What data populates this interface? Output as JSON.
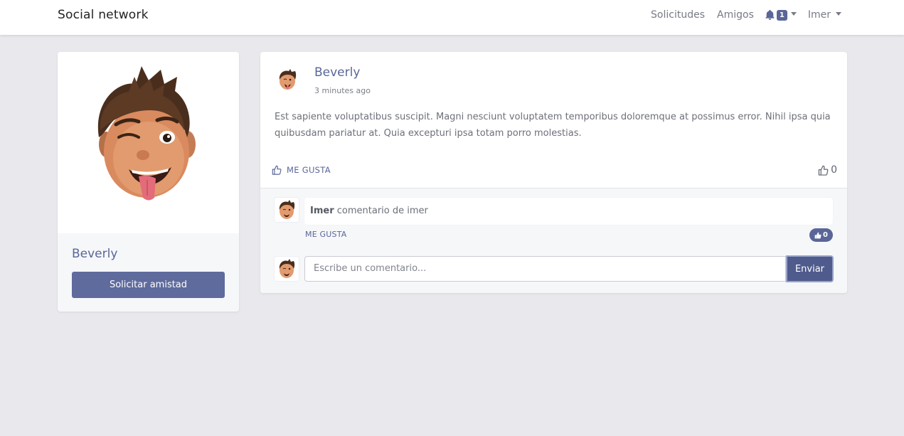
{
  "navbar": {
    "brand": "Social network",
    "links": [
      "Solicitudes",
      "Amigos"
    ],
    "notifications_count": "1",
    "user_menu": "Imer"
  },
  "profile": {
    "name": "Beverly",
    "button_label": "Solicitar amistad"
  },
  "post": {
    "author": "Beverly",
    "time": "3 minutes ago",
    "body": "Est sapiente voluptatibus suscipit. Magni nesciunt voluptatem temporibus doloremque at possimus error. Nihil ipsa quia quibusdam pariatur at. Quia excepturi ipsa totam porro molestias.",
    "like_label": "ME GUSTA",
    "like_count": "0"
  },
  "comment": {
    "author": "Imer",
    "text": "comentario de imer",
    "like_label": "ME GUSTA",
    "like_count": "0"
  },
  "new_comment": {
    "placeholder": "Escribe un comentario...",
    "send_label": "Enviar"
  },
  "colors": {
    "accent": "#5a6698",
    "button": "#5f6b9d",
    "background": "#e9e9ed"
  }
}
